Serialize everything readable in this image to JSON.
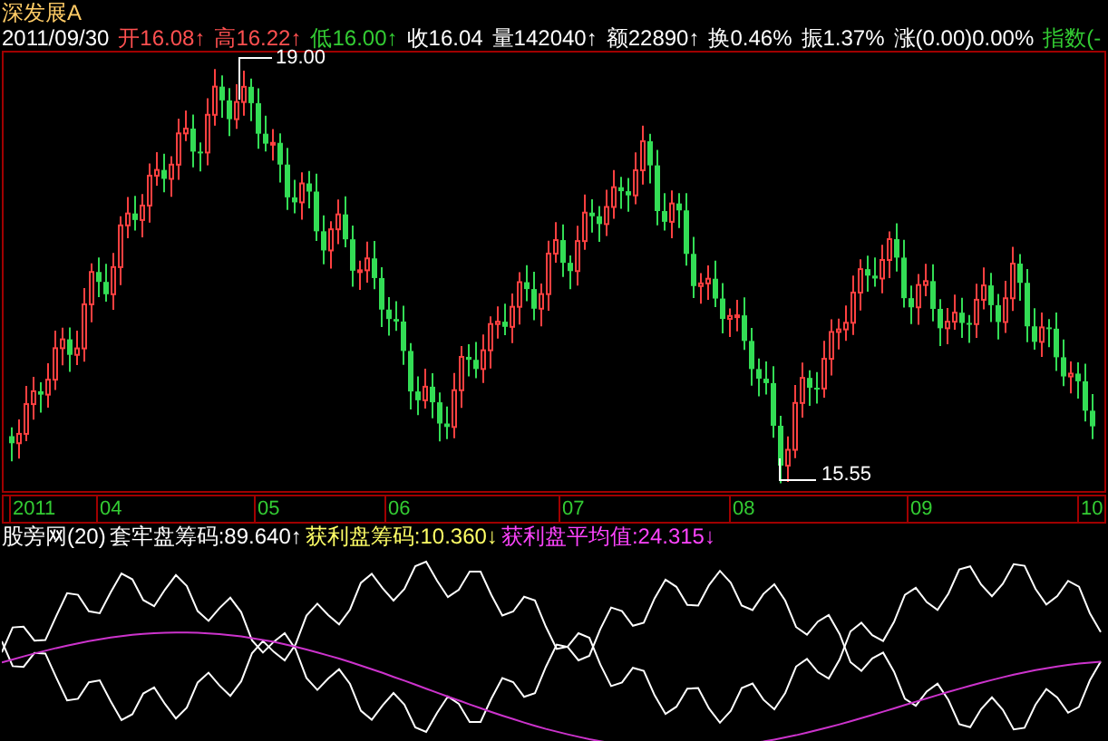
{
  "stock": {
    "name": "深发展A"
  },
  "quote": [
    {
      "text": "2011/09/30",
      "color": "#ffffff"
    },
    {
      "text": "开16.08",
      "color": "#ff5050",
      "arrow": "↑"
    },
    {
      "text": "高16.22",
      "color": "#ff5050",
      "arrow": "↑"
    },
    {
      "text": "低16.00",
      "color": "#33cc33",
      "arrow": "↑"
    },
    {
      "text": "收16.04",
      "color": "#ffffff"
    },
    {
      "text": "量142040",
      "color": "#ffffff",
      "arrow": "↑"
    },
    {
      "text": "额22890",
      "color": "#ffffff",
      "arrow": "↑"
    },
    {
      "text": "换0.46%",
      "color": "#ffffff"
    },
    {
      "text": "振1.37%",
      "color": "#ffffff"
    },
    {
      "text": "涨(0.00)0.00%",
      "color": "#ffffff"
    },
    {
      "text": "指数(-",
      "color": "#33cc33"
    }
  ],
  "price_chart": {
    "high_label": "19.00",
    "low_label": "15.55"
  },
  "months": [
    "2011",
    "04",
    "05",
    "06",
    "07",
    "08",
    "09",
    "10"
  ],
  "indicator": {
    "name": "股旁网(20)",
    "legend": [
      {
        "text": "套牢盘筹码:89.640↑",
        "color": "#ffffff"
      },
      {
        "text": "获利盘筹码:10.360↓",
        "color": "#ffff66"
      },
      {
        "text": "获利盘平均值:24.315↓",
        "color": "#ff44ff"
      }
    ]
  }
}
